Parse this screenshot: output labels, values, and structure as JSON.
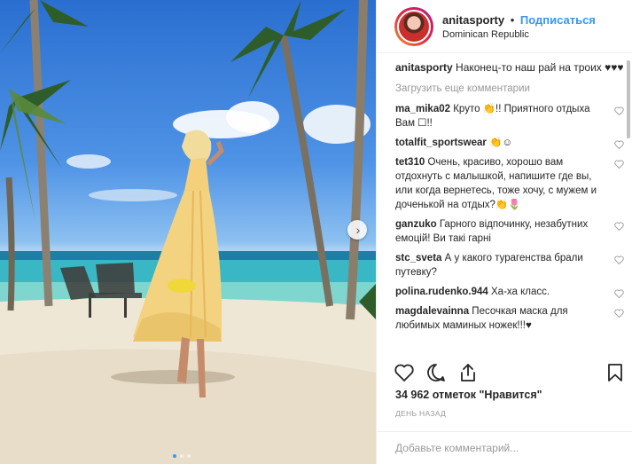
{
  "post": {
    "username": "anitasporty",
    "separator": "•",
    "follow_label": "Подписаться",
    "location": "Dominican Republic",
    "caption_text": "Наконец-то наш рай на троих ♥♥♥"
  },
  "load_more_label": "Загрузить еще комментарии",
  "comments": [
    {
      "user": "ma_mika02",
      "text": "Круто 👏!! Приятного отдыха Вам ☐!!"
    },
    {
      "user": "totalfit_sportswear",
      "text": "👏☺"
    },
    {
      "user": "tet310",
      "text": "Очень, красиво, хорошо вам отдохнуть с малышкой, напишите где вы, или когда вернетесь, тоже хочу, с мужем и доченькой на отдых?👏🌷"
    },
    {
      "user": "ganzuko",
      "text": "Гарного відпочинку, незабутних емоцій! Ви такі гарні"
    },
    {
      "user": "stc_sveta",
      "text": "А у какого турагенства брали путевку?"
    },
    {
      "user": "polina.rudenko.944",
      "text": "Ха-ха класс."
    },
    {
      "user": "magdalevainna",
      "text": "Песочкая маска для любимых маминых ножек!!!♥"
    }
  ],
  "likes_label": "34 962 отметок \"Нравится\"",
  "time_ago": "ДЕНЬ НАЗАД",
  "add_comment_placeholder": "Добавьте комментарий...",
  "icons": {
    "like": "heart-icon",
    "comment": "comment-icon",
    "share": "share-icon",
    "save": "bookmark-icon",
    "next": "chevron-right-icon"
  },
  "colors": {
    "accent": "#3897f0",
    "text": "#262626",
    "muted": "#999999"
  }
}
